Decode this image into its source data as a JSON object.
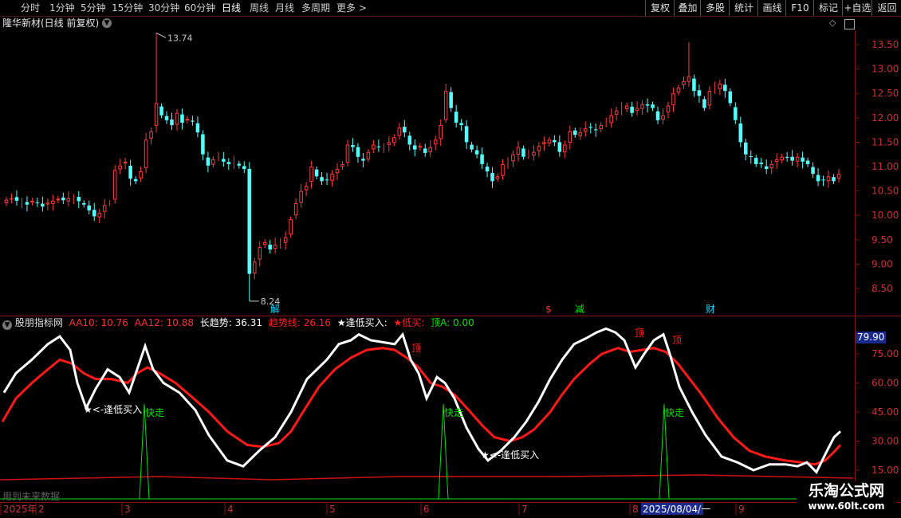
{
  "toolbar": {
    "periods": [
      "分时",
      "1分钟",
      "5分钟",
      "15分钟",
      "30分钟",
      "60分钟",
      "日线",
      "周线",
      "月线",
      "多周期",
      "更多 >"
    ],
    "active": "日线",
    "right_buttons": [
      "复权",
      "叠加",
      "多股",
      "统计",
      "画线",
      "F10",
      "标记",
      "+自选",
      "返回"
    ]
  },
  "main": {
    "title": "隆华新材(日线 前复权)",
    "price_ticks": [
      "13.50",
      "13.00",
      "12.50",
      "12.00",
      "11.50",
      "11.00",
      "10.50",
      "10.00",
      "9.50",
      "9.00",
      "8.50"
    ],
    "high_label": "13.74",
    "low_label": "8.24",
    "events": [
      {
        "text": "解",
        "color": "#00d8ff"
      },
      {
        "text": "$",
        "color": "#ff3030"
      },
      {
        "text": "减",
        "color": "#00e000"
      },
      {
        "text": "财",
        "color": "#00d8ff"
      }
    ]
  },
  "indicator": {
    "name": "股朋指标网",
    "aa10": "AA10: 10.76",
    "aa12": "AA12: 10.88",
    "long_trend": "长趋势: 36.31",
    "trend_line": "趋势线: 26.16",
    "buy_low": "★逢低买入:",
    "low_buy": "★低买:",
    "top_a": "顶A: 0.00",
    "ticks": [
      "75.00",
      "60.00",
      "45.00",
      "30.00",
      "15.00"
    ],
    "current_value": "79.90",
    "annotations": {
      "buy": "★<-逢低买入",
      "fast": "快走",
      "top": "顶",
      "future": "用到未来数据"
    }
  },
  "xaxis": {
    "labels": [
      "2025年",
      "2",
      "3",
      "4",
      "5",
      "6",
      "7",
      "8",
      "9"
    ],
    "cursor_date": "2025/08/04/一"
  },
  "watermark": {
    "title": "乐淘公式网",
    "url": "www.60lt.com"
  },
  "colors": {
    "up": "#ff3b3b",
    "down": "#54ffff",
    "white_line": "#ffffff",
    "red_line": "#ff1a1a",
    "green": "#00e000",
    "grid": "#7a0000"
  }
}
